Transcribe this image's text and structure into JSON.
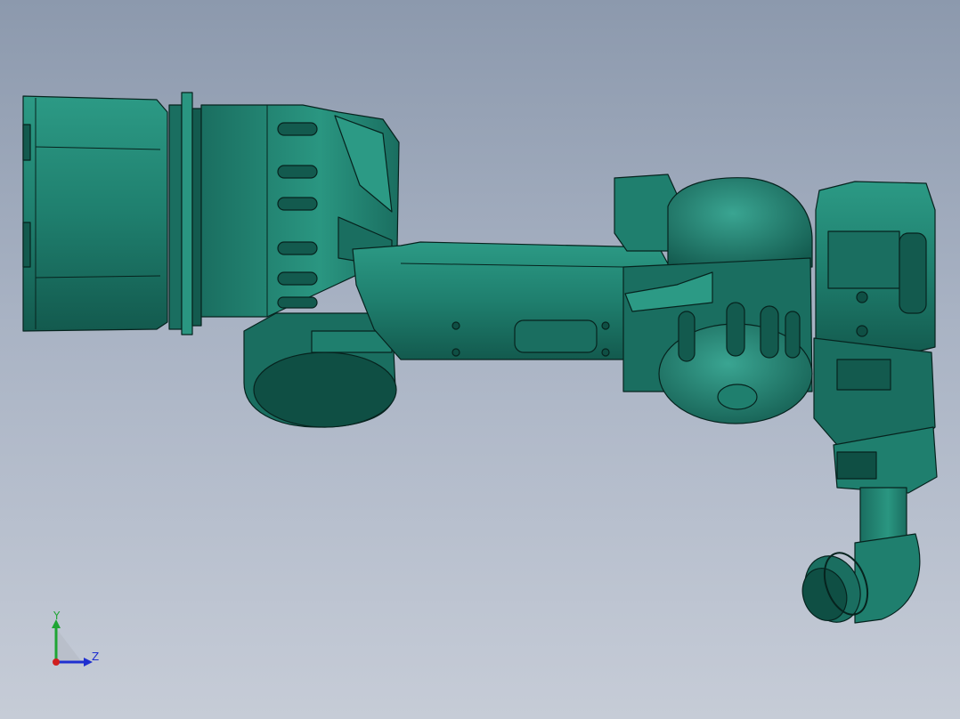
{
  "viewport": {
    "background_top": "#8c99ad",
    "background_bottom": "#c6ccd7"
  },
  "model": {
    "body_color": "#1f7f6e",
    "dark_color": "#0f4f44",
    "light_color": "#3aa592",
    "edge_color": "#06231e"
  },
  "triad": {
    "y_label": "Y",
    "z_label": "Z",
    "y_color": "#1fa534",
    "z_color": "#1f2fd0",
    "x_color": "#d01f1f"
  }
}
